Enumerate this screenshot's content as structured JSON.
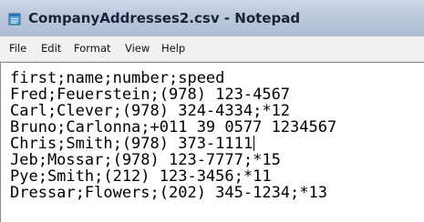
{
  "window": {
    "title": "CompanyAddresses2.csv - Notepad",
    "icon": "notepad-icon"
  },
  "menu": {
    "file": "File",
    "edit": "Edit",
    "format": "Format",
    "view": "View",
    "help": "Help"
  },
  "editor": {
    "lines": [
      "first;name;number;speed",
      "Fred;Feuerstein;(978) 123-4567",
      "Carl;Clever;(978) 324-4334;*12",
      "Bruno;Carlonna;+011 39 0577 1234567",
      "Chris;Smith;(978) 373-1111",
      "Jeb;Mossar;(978) 123-7777;*15",
      "Pye;Smith;(212) 123-3456;*11",
      "Dressar;Flowers;(202) 345-1234;*13"
    ],
    "caret_line": 5
  }
}
